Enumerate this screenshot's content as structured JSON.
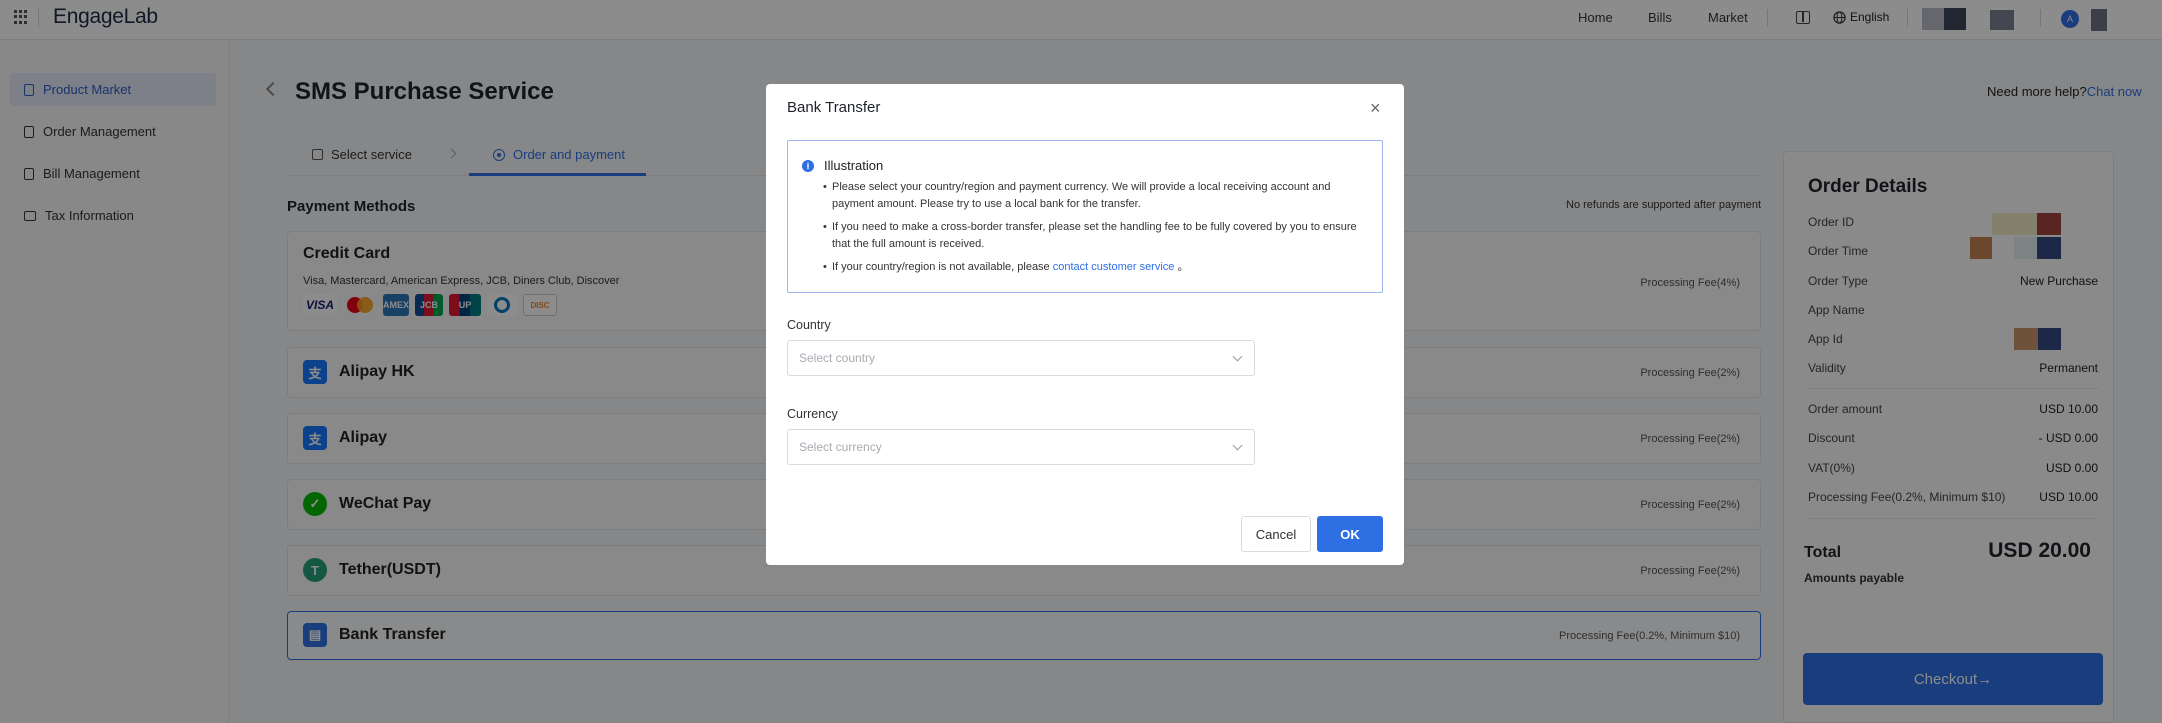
{
  "topbar": {
    "logo": "EngageLab",
    "nav": [
      "Home",
      "Bills",
      "Market"
    ],
    "language": "English",
    "avatar_initial": "A"
  },
  "sidebar": {
    "items": [
      {
        "label": "Product Market",
        "active": true
      },
      {
        "label": "Order Management",
        "active": false
      },
      {
        "label": "Bill Management",
        "active": false
      },
      {
        "label": "Tax Information",
        "active": false
      }
    ]
  },
  "page": {
    "title": "SMS Purchase Service",
    "help_text": "Need more help?",
    "help_link": "Chat now"
  },
  "steps": [
    {
      "label": "Select service",
      "active": false
    },
    {
      "label": "Order and payment",
      "active": true
    }
  ],
  "payment": {
    "title": "Payment Methods",
    "no_refund": "No refunds are supported after payment",
    "methods": [
      {
        "name": "Credit Card",
        "subtitle": "Visa, Mastercard, American Express, JCB, Diners Club, Discover",
        "fee": "Processing Fee(4%)"
      },
      {
        "name": "Alipay HK",
        "fee": "Processing Fee(2%)"
      },
      {
        "name": "Alipay",
        "fee": "Processing Fee(2%)"
      },
      {
        "name": "WeChat Pay",
        "fee": "Processing Fee(2%)"
      },
      {
        "name": "Tether(USDT)",
        "fee": "Processing Fee(2%)"
      },
      {
        "name": "Bank Transfer",
        "fee": "Processing Fee(0.2%, Minimum $10)",
        "selected": true
      }
    ],
    "card_logos": [
      "VISA",
      "MC",
      "AMEX",
      "JCB",
      "UP",
      "DC",
      "DISC"
    ]
  },
  "order": {
    "title": "Order Details",
    "rows": [
      {
        "label": "Order ID",
        "value": ""
      },
      {
        "label": "Order Time",
        "value": ""
      },
      {
        "label": "Order Type",
        "value": "New Purchase"
      },
      {
        "label": "App Name",
        "value": ""
      },
      {
        "label": "App Id",
        "value": ""
      },
      {
        "label": "Validity",
        "value": "Permanent"
      }
    ],
    "amounts": [
      {
        "label": "Order amount",
        "value": "USD 10.00"
      },
      {
        "label": "Discount",
        "value": "- USD 0.00"
      },
      {
        "label": "VAT(0%)",
        "value": "USD 0.00"
      },
      {
        "label": "Processing Fee(0.2%, Minimum $10)",
        "value": "USD 10.00"
      }
    ],
    "total_label": "Total",
    "total_value": "USD 20.00",
    "payable": "Amounts payable",
    "checkout": "Checkout→"
  },
  "modal": {
    "title": "Bank Transfer",
    "close": "×",
    "illustration_title": "Illustration",
    "bullets": [
      "Please select your country/region and payment currency. We will provide a local receiving account and payment amount. Please try to use a local bank for the transfer.",
      "If you need to make a cross-border transfer, please set the handling fee to be fully covered by you to ensure that the full amount is received."
    ],
    "bullet3_prefix": "If your country/region is not available, please ",
    "bullet3_link": "contact customer service",
    "bullet3_suffix": " 。",
    "country_label": "Country",
    "country_placeholder": "Select country",
    "currency_label": "Currency",
    "currency_placeholder": "Select currency",
    "cancel": "Cancel",
    "ok": "OK"
  },
  "colors": {
    "accent": "#2f6fe4",
    "overlay": "rgba(0,0,0,0.45)"
  }
}
